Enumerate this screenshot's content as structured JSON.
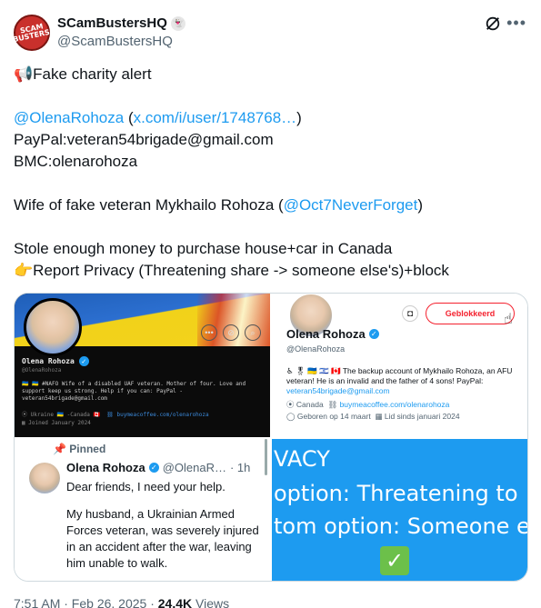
{
  "author": {
    "display_name": "SCamBustersHQ",
    "handle": "@ScamBustersHQ",
    "avatar_text_1": "SCAM",
    "avatar_text_2": "BUSTERS"
  },
  "tweet": {
    "line1_emoji": "📢",
    "line1_text": "Fake charity alert",
    "mention": "@OlenaRohoza",
    "link_open": "(",
    "link": "x.com/i/user/1748768…",
    "link_close": ")",
    "paypal": "PayPal:veteran54brigade@gmail.com",
    "bmc": "BMC:olenarohoza",
    "wife_text": "Wife of fake veteran Mykhailo Rohoza (",
    "wife_mention": "@Oct7NeverForget",
    "wife_close": ")",
    "stole": "Stole enough money to purchase house+car in Canada",
    "report_emoji": "👉",
    "report": "Report Privacy (Threatening share -> someone else's)+block"
  },
  "media": {
    "tile1": {
      "name": "Olena Rohoza",
      "handle": "@OlenaRohoza",
      "bio": "🇺🇦 🇺🇦 #NAFO Wife of a disabled UAF veteran. Mother of four. Love and support keep us strong. Help if you can: PayPal - veteran54brigade@gmail.com",
      "location": "Ukraine 🇺🇦 -Canada 🇨🇦",
      "link": "buymeacoffee.com/olenarohoza",
      "joined": "Joined January 2024"
    },
    "tile2": {
      "button": "Geblokkeerd",
      "name": "Olena Rohoza",
      "handle": "@OlenaRohoza",
      "bio_prefix": "♿ 🎖 🇺🇦 🇮🇱 🇨🇦 The backup account of Mykhailo Rohoza, an AFU veteran! He is an invalid and the father of 4 sons! PayPal: ",
      "bio_link": "veteran54brigade@gmail.com",
      "location": "Canada",
      "link": "buymeacoffee.com/olenarohoza",
      "born": "Geboren op 14 maart",
      "joined": "Lid sinds januari 2024"
    },
    "tile3": {
      "pinned": "Pinned",
      "name": "Olena Rohoza",
      "handle": "@OlenaR…",
      "time": "· 1h",
      "body": "Dear friends, I need your help.",
      "body2": "My husband, a Ukrainian Armed Forces veteran, was severely injured in an accident after the war, leaving him unable to walk."
    },
    "tile4": {
      "line1": "VACY",
      "line2": "option: Threatening to",
      "line3": "tom option: Someone e"
    }
  },
  "footer": {
    "time": "7:51 AM · Feb 26, 2025 · ",
    "views_count": "24.4K",
    "views_label": " Views"
  }
}
